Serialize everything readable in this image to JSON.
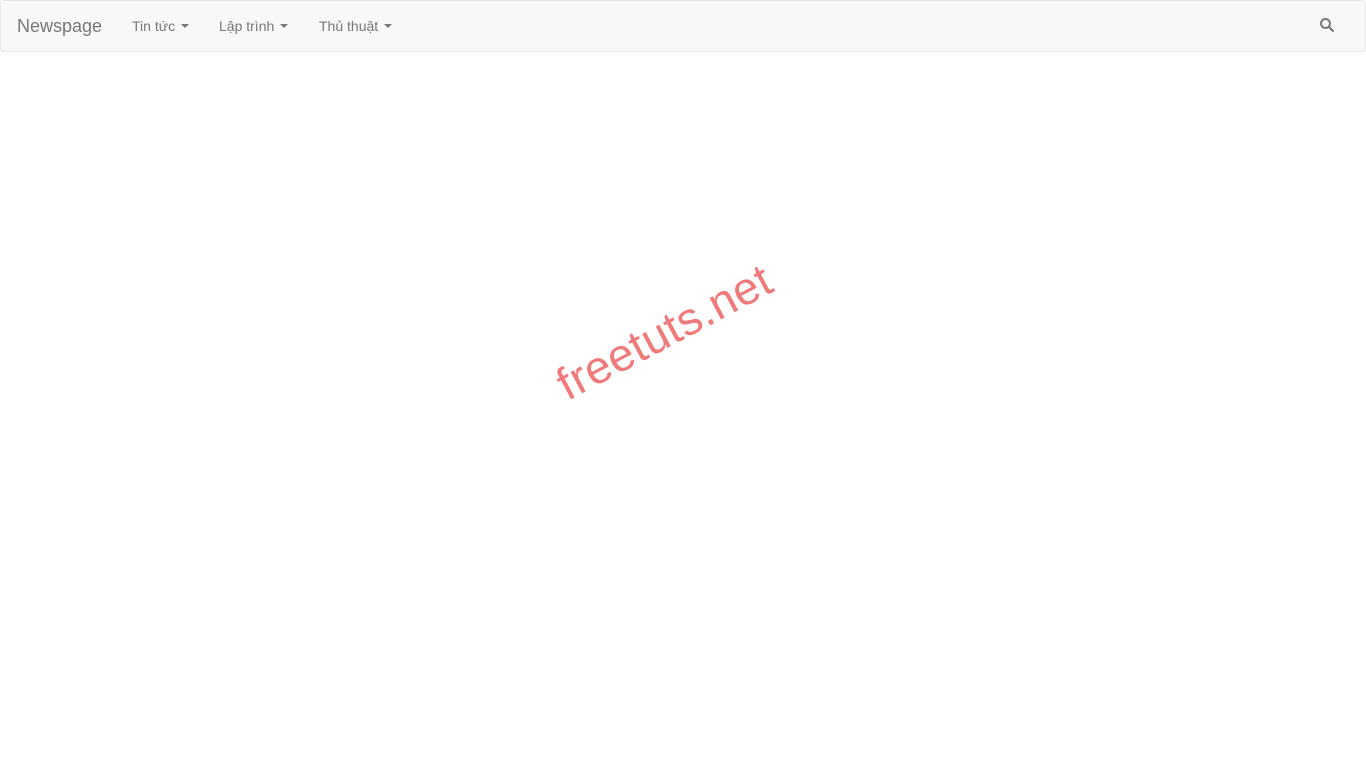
{
  "navbar": {
    "brand": "Newspage",
    "items": [
      {
        "label": "Tin tức"
      },
      {
        "label": "Lập trình"
      },
      {
        "label": "Thủ thuật"
      }
    ],
    "search_icon": "search-icon"
  },
  "watermark": "freetuts.net",
  "colors": {
    "navbar_bg": "#f8f8f8",
    "navbar_border": "#e7e7e7",
    "nav_text": "#777777",
    "watermark": "#f07a7a"
  }
}
